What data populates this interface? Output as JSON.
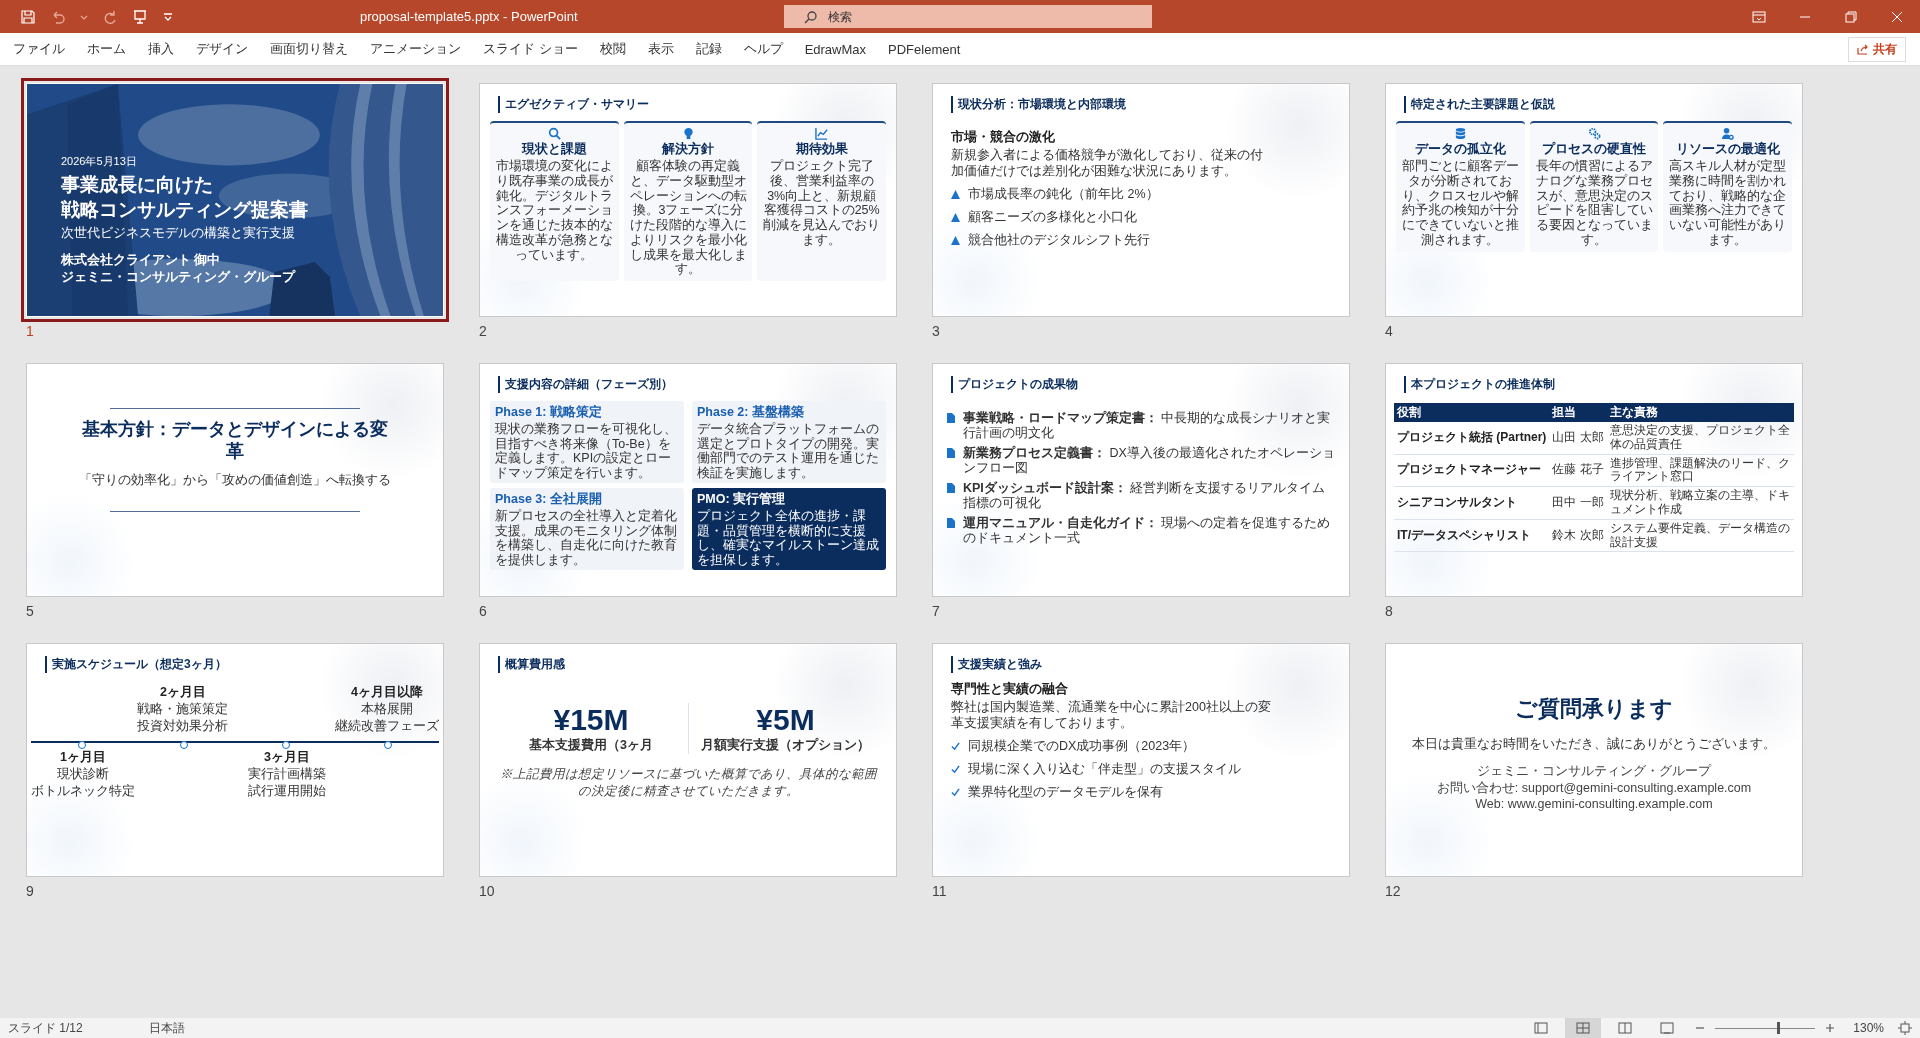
{
  "window": {
    "title": "proposal-template5.pptx  -  PowerPoint",
    "search": {
      "placeholder": "検索"
    }
  },
  "ribbon_tabs": [
    "ファイル",
    "ホーム",
    "挿入",
    "デザイン",
    "画面切り替え",
    "アニメーション",
    "スライド ショー",
    "校閲",
    "表示",
    "記録",
    "ヘルプ",
    "EdrawMax",
    "PDFelement"
  ],
  "share_button": "共有",
  "slides": [
    {
      "number": "1",
      "selected": true,
      "kind": "cover",
      "date": "2026年5月13日",
      "title_lines": [
        "事業成長に向けた",
        "戦略コンサルティング提案書"
      ],
      "subtitle": "次世代ビジネスモデルの構築と実行支援",
      "client": "株式会社クライアント 御中",
      "company": "ジェミニ・コンサルティング・グループ"
    },
    {
      "number": "2",
      "selected": false,
      "kind": "cards",
      "title": "エグゼクティブ・サマリー",
      "cards": [
        {
          "heading": "現状と課題",
          "body": "市場環境の変化により既存事業の成長が鈍化。デジタルトランスフォーメーションを通じた抜本的な構造改革が急務となっています。"
        },
        {
          "heading": "解決方針",
          "body": "顧客体験の再定義と、データ駆動型オペレーションへの転換。3フェーズに分けた段階的な導入によりリスクを最小化し成果を最大化します。"
        },
        {
          "heading": "期待効果",
          "body": "プロジェクト完了後、営業利益率の3%向上と、新規顧客獲得コストの25%削減を見込んでおります。"
        }
      ]
    },
    {
      "number": "3",
      "selected": false,
      "kind": "analysis",
      "title": "現状分析：市場環境と内部環境",
      "heading": "市場・競合の激化",
      "paragraph": "新規参入者による価格競争が激化しており、従来の付加価値だけでは差別化が困難な状況にあります。",
      "bullets": [
        "市場成長率の鈍化（前年比 2%）",
        "顧客ニーズの多様化と小口化",
        "競合他社のデジタルシフト先行"
      ]
    },
    {
      "number": "4",
      "selected": false,
      "kind": "cards",
      "title": "特定された主要課題と仮説",
      "cards": [
        {
          "heading": "データの孤立化",
          "body": "部門ごとに顧客データが分断されており、クロスセルや解約予兆の検知が十分にできていないと推測されます。"
        },
        {
          "heading": "プロセスの硬直性",
          "body": "長年の慣習によるアナログな業務プロセスが、意思決定のスピードを阻害している要因となっています。"
        },
        {
          "heading": "リソースの最適化",
          "body": "高スキル人材が定型業務に時間を割かれており、戦略的な企画業務へ注力できていない可能性があります。"
        }
      ]
    },
    {
      "number": "5",
      "selected": false,
      "kind": "statement",
      "title": "基本方針：データとデザインによる変革",
      "subtitle": "「守りの効率化」から「攻めの価値創造」へ転換する"
    },
    {
      "number": "6",
      "selected": false,
      "kind": "phases",
      "title": "支援内容の詳細（フェーズ別）",
      "phases": [
        {
          "kind": "phase",
          "heading": "Phase 1: 戦略策定",
          "body": "現状の業務フローを可視化し、目指すべき将来像（To-Be）を定義します。KPIの設定とロードマップ策定を行います。"
        },
        {
          "kind": "phase",
          "heading": "Phase 2: 基盤構築",
          "body": "データ統合プラットフォームの選定とプロトタイプの開発。実働部門でのテスト運用を通じた検証を実施します。"
        },
        {
          "kind": "phase",
          "heading": "Phase 3: 全社展開",
          "body": "新プロセスの全社導入と定着化支援。成果のモニタリング体制を構築し、自走化に向けた教育を提供します。"
        },
        {
          "kind": "highlight",
          "heading": "PMO: 実行管理",
          "body": "プロジェクト全体の進捗・課題・品質管理を横断的に支援し、確実なマイルストーン達成を担保します。"
        }
      ]
    },
    {
      "number": "7",
      "selected": false,
      "kind": "deliverables",
      "title": "プロジェクトの成果物",
      "items": [
        {
          "label": "事業戦略・ロードマップ策定書：",
          "text": "中長期的な成長シナリオと実行計画の明文化"
        },
        {
          "label": "新業務プロセス定義書：",
          "text": "DX導入後の最適化されたオペレーションフロー図"
        },
        {
          "label": "KPIダッシュボード設計案：",
          "text": "経営判断を支援するリアルタイム指標の可視化"
        },
        {
          "label": "運用マニュアル・自走化ガイド：",
          "text": "現場への定着を促進するためのドキュメント一式"
        }
      ]
    },
    {
      "number": "8",
      "selected": false,
      "kind": "table",
      "title": "本プロジェクトの推進体制",
      "columns": [
        "役割",
        "担当",
        "主な責務"
      ],
      "rows": [
        [
          "プロジェクト統括 (Partner)",
          "山田 太郎",
          "意思決定の支援、プロジェクト全体の品質責任"
        ],
        [
          "プロジェクトマネージャー",
          "佐藤 花子",
          "進捗管理、課題解決のリード、クライアント窓口"
        ],
        [
          "シニアコンサルタント",
          "田中 一郎",
          "現状分析、戦略立案の主導、ドキュメント作成"
        ],
        [
          "IT/データスペシャリスト",
          "鈴木 次郎",
          "システム要件定義、データ構造の設計支援"
        ]
      ]
    },
    {
      "number": "9",
      "selected": false,
      "kind": "timeline",
      "title": "実施スケジュール（想定3ヶ月）",
      "milestones": [
        {
          "label": "1ヶ月目",
          "lines": [
            "現状診断",
            "ボトルネック特定"
          ]
        },
        {
          "label": "2ヶ月目",
          "lines": [
            "戦略・施策策定",
            "投資対効果分析"
          ]
        },
        {
          "label": "3ヶ月目",
          "lines": [
            "実行計画構築",
            "試行運用開始"
          ]
        },
        {
          "label": "4ヶ月目以降",
          "lines": [
            "本格展開",
            "継続改善フェーズ"
          ]
        }
      ]
    },
    {
      "number": "10",
      "selected": false,
      "kind": "pricing",
      "title": "概算費用感",
      "prices": [
        {
          "value": "¥15M",
          "label": "基本支援費用（3ヶ月"
        },
        {
          "value": "¥5M",
          "label": "月額実行支援（オプション）"
        }
      ],
      "note": "※上記費用は想定リソースに基づいた概算であり、具体的な範囲の決定後に精査させていただきます。"
    },
    {
      "number": "11",
      "selected": false,
      "kind": "strengths",
      "title": "支援実績と強み",
      "heading": "専門性と実績の融合",
      "paragraph": "弊社は国内製造業、流通業を中心に累計200社以上の変革支援実績を有しております。",
      "bullets": [
        "同規模企業でのDX成功事例（2023年）",
        "現場に深く入り込む「伴走型」の支援スタイル",
        "業界特化型のデータモデルを保有"
      ]
    },
    {
      "number": "12",
      "selected": false,
      "kind": "closing",
      "title": "ご質問承ります",
      "message": "本日は貴重なお時間をいただき、誠にありがとうございます。",
      "contact_lines": [
        "ジェミニ・コンサルティング・グループ",
        "お問い合わせ: support@gemini-consulting.example.com",
        "Web: www.gemini-consulting.example.com"
      ]
    }
  ],
  "status_bar": {
    "slide_info": "スライド 1/12",
    "language": "日本語",
    "views": [
      {
        "selected": false
      },
      {
        "selected": true
      },
      {
        "selected": false
      },
      {
        "selected": false
      }
    ],
    "zoom": {
      "level": 0.63,
      "text": "130%"
    }
  }
}
